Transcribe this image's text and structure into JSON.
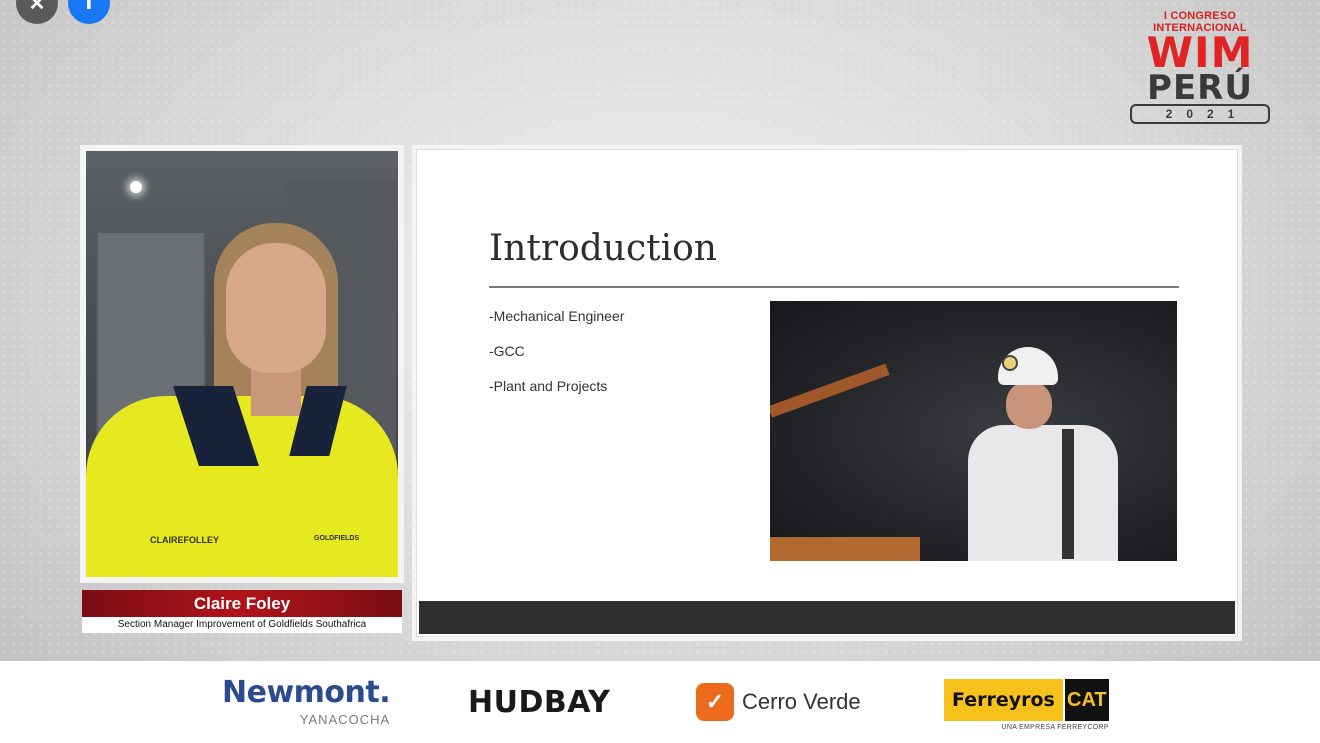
{
  "controls": {
    "close_glyph": "✕",
    "facebook_glyph": "f"
  },
  "event": {
    "subtitle": "I CONGRESO INTERNACIONAL",
    "brand_main": "WIM",
    "brand_country": "PERÚ",
    "year": "2021"
  },
  "speaker": {
    "name": "Claire Foley",
    "role": "Section Manager Improvement  of Goldfields Southafrica",
    "badge_name": "CLAIREFOLLEY",
    "badge_company": "GOLDFIELDS"
  },
  "slide": {
    "title": "Introduction",
    "bullets": [
      "-Mechanical Engineer",
      "-GCC",
      "-Plant and Projects"
    ]
  },
  "sponsors": {
    "newmont": {
      "name": "Newmont.",
      "sub": "YANACOCHA"
    },
    "hudbay": {
      "name": "HUDBAY"
    },
    "cerro_verde": {
      "mark": "✓",
      "name": "Cerro Verde"
    },
    "ferreyros": {
      "name": "Ferreyros",
      "cat": "CAT",
      "sub": "UNA EMPRESA FERREYCORP"
    }
  },
  "colors": {
    "accent_red": "#b0141a",
    "newmont_blue": "#2c4a8f",
    "cerro_orange": "#ee6a1c",
    "cat_yellow": "#f6c11a"
  }
}
